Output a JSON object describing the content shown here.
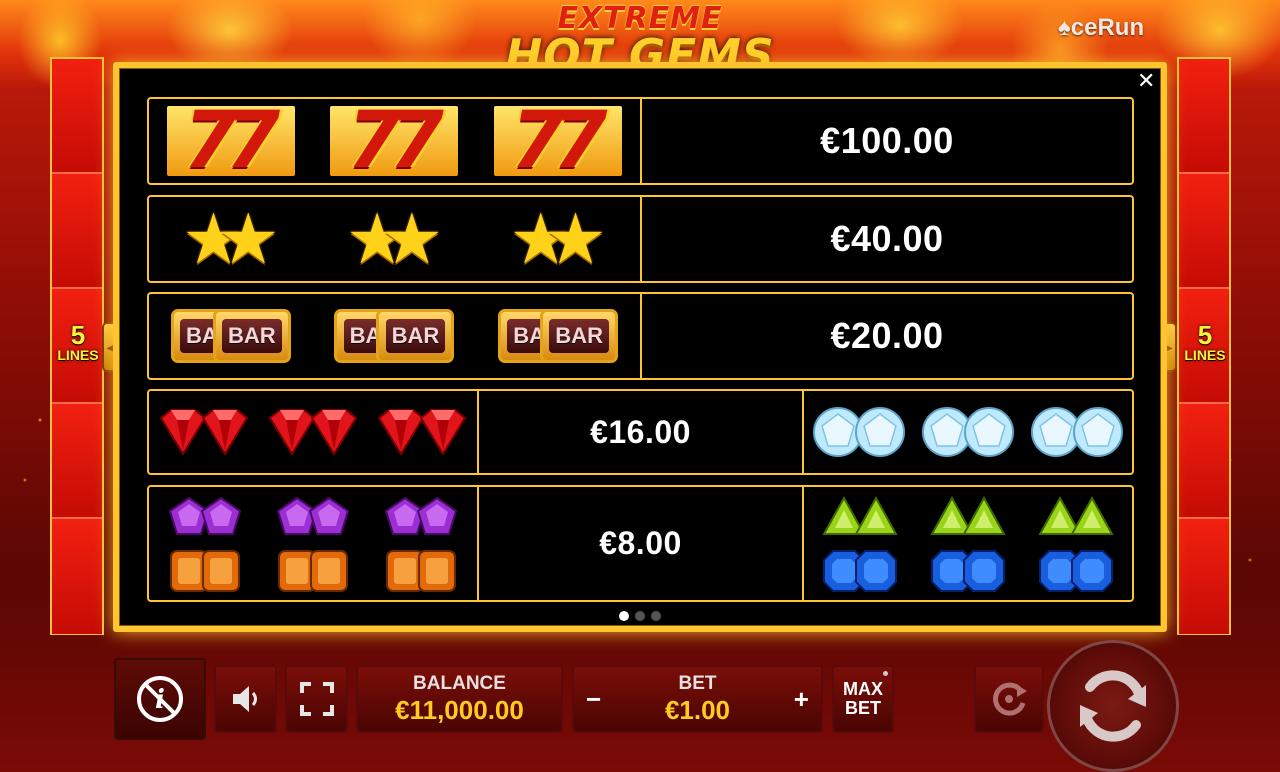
{
  "logo": {
    "line1": "EXTREME",
    "line2": "HOT GEMS"
  },
  "brand": "ceRun",
  "lines": {
    "count": "5",
    "label": "LINES"
  },
  "paytable": {
    "rows": [
      {
        "symbol": "seven",
        "prize": "€100.00"
      },
      {
        "symbol": "star",
        "prize": "€40.00"
      },
      {
        "symbol": "bar",
        "bar_text": "BAR",
        "prize": "€20.00"
      },
      {
        "symbol_left": "red-gem",
        "symbol_right": "white-diamond",
        "prize": "€16.00"
      },
      {
        "symbols_left": [
          "purple-gem",
          "orange-gem"
        ],
        "symbols_right": [
          "green-gem",
          "blue-gem"
        ],
        "prize": "€8.00"
      }
    ],
    "page": 1,
    "pages": 3
  },
  "controls": {
    "balance_label": "BALANCE",
    "balance_value": "€11,000.00",
    "bet_label": "BET",
    "bet_value": "€1.00",
    "minus": "−",
    "plus": "+",
    "maxbet_l1": "MAX",
    "maxbet_l2": "BET"
  },
  "colors": {
    "gold": "#ffc531",
    "accent_value": "#ffcc1f",
    "background_red": "#c81d0a"
  }
}
